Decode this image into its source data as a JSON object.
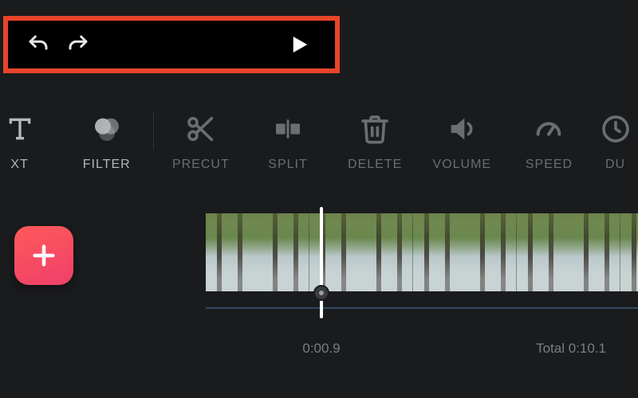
{
  "highlight_color": "#e8452b",
  "playback": {
    "undo": "undo",
    "redo": "redo",
    "play": "play"
  },
  "toolbar": {
    "items": [
      {
        "id": "text",
        "label": "XT",
        "icon": "text",
        "enabled": true,
        "partial": true
      },
      {
        "id": "filter",
        "label": "FILTER",
        "icon": "filter",
        "enabled": true
      },
      {
        "id": "precut",
        "label": "PRECUT",
        "icon": "scissors",
        "enabled": false
      },
      {
        "id": "split",
        "label": "SPLIT",
        "icon": "split",
        "enabled": false
      },
      {
        "id": "delete",
        "label": "DELETE",
        "icon": "trash",
        "enabled": false
      },
      {
        "id": "volume",
        "label": "VOLUME",
        "icon": "volume",
        "enabled": false
      },
      {
        "id": "speed",
        "label": "SPEED",
        "icon": "gauge",
        "enabled": false
      },
      {
        "id": "duration",
        "label": "DU",
        "icon": "clock",
        "enabled": false,
        "partial": true
      }
    ]
  },
  "timeline": {
    "add_label": "+",
    "current_time": "0:00.9",
    "total_time_label": "Total 0:10.1"
  }
}
